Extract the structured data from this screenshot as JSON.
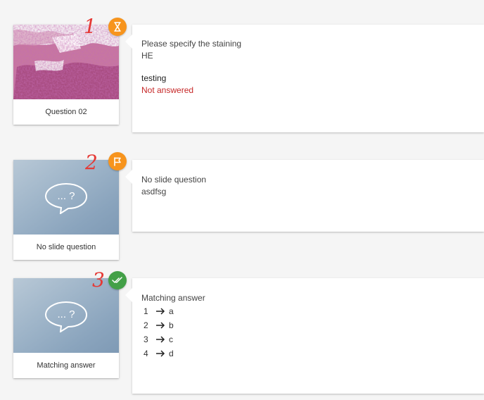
{
  "questions": [
    {
      "annotation": "1",
      "thumbnail_caption": "Question 02",
      "badge_icon": "hourglass-icon",
      "badge_color": "#f7941d",
      "title": "Please specify the staining",
      "value": "HE",
      "sub_label": "testing",
      "sub_status": "Not answered"
    },
    {
      "annotation": "2",
      "thumbnail_caption": "No slide question",
      "badge_icon": "flag-icon",
      "badge_color": "#f7941d",
      "title": "No slide question",
      "value": "asdfsg",
      "placeholder_text": "... ?"
    },
    {
      "annotation": "3",
      "thumbnail_caption": "Matching answer",
      "badge_icon": "double-check-icon",
      "badge_color": "#43a047",
      "title": "Matching answer",
      "placeholder_text": "... ?",
      "matches": [
        {
          "left": "1",
          "right": "a"
        },
        {
          "left": "2",
          "right": "b"
        },
        {
          "left": "3",
          "right": "c"
        },
        {
          "left": "4",
          "right": "d"
        }
      ]
    }
  ],
  "colors": {
    "orange_badge": "#f7941d",
    "green_badge": "#43a047",
    "not_answered": "#c62828",
    "annotation_red": "#e53935"
  }
}
